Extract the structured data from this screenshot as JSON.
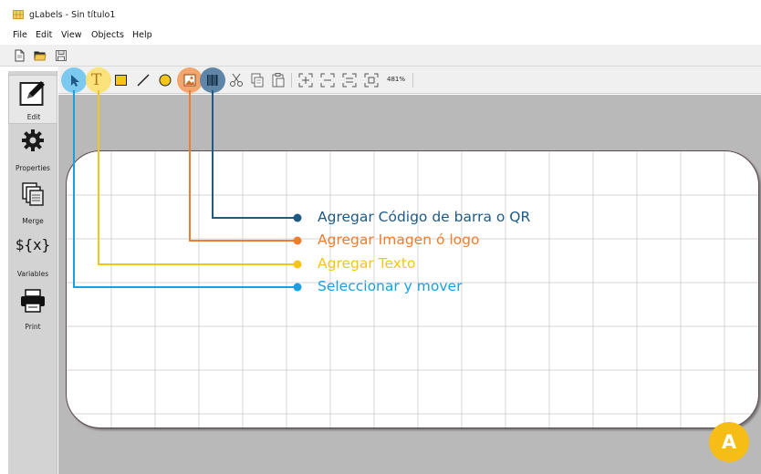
{
  "window": {
    "title": "gLabels - Sin título1"
  },
  "menu": [
    "File",
    "Edit",
    "View",
    "Objects",
    "Help"
  ],
  "sidebar": [
    {
      "label": "Edit",
      "icon": "pencil-icon",
      "active": true
    },
    {
      "label": "Properties",
      "icon": "gear-icon"
    },
    {
      "label": "Merge",
      "icon": "merge-icon"
    },
    {
      "label": "Variables",
      "icon": "variables-icon",
      "glyph": "${x}"
    },
    {
      "label": "Print",
      "icon": "printer-icon"
    }
  ],
  "toolbar": {
    "text_tool_glyph": "T",
    "zoom": "481%"
  },
  "annotations": [
    {
      "text": "Agregar Código de barra o QR",
      "color": "#1f5a85"
    },
    {
      "text": "Agregar Imagen ó logo",
      "color": "#ee7e2f"
    },
    {
      "text": "Agregar Texto",
      "color": "#f5c518"
    },
    {
      "text": "Seleccionar y mover",
      "color": "#1aa0e0"
    }
  ],
  "badge": "A",
  "colors": {
    "sidebar_bg": "#d3d3d3",
    "canvas_bg": "#b9b9b9",
    "toolbar_bg": "#f0f0f0",
    "grid": "#d4d4d4",
    "badge": "#f6bd16"
  }
}
